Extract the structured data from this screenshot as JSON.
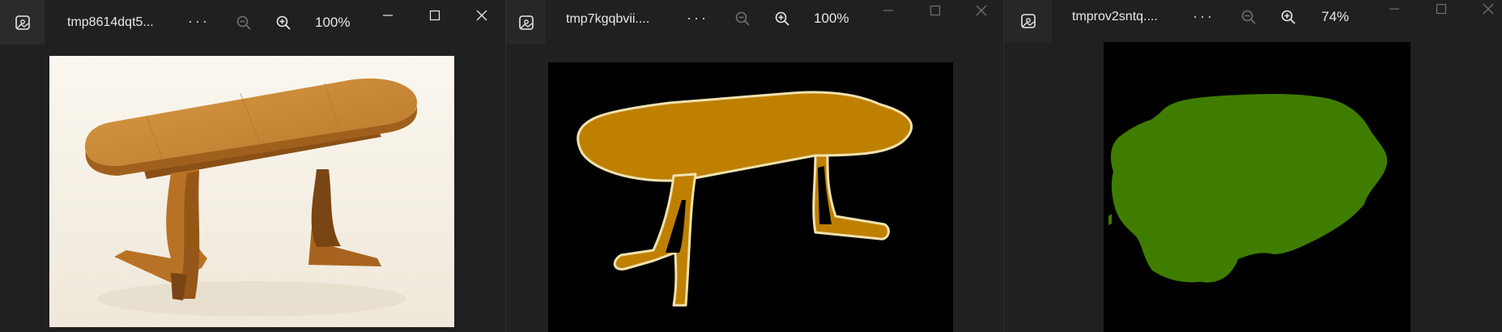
{
  "windows": [
    {
      "file_name": "tmp8614dqt5...",
      "zoom": "100%",
      "more": "···"
    },
    {
      "file_name": "tmp7kgqbvii....",
      "zoom": "100%",
      "more": "···"
    },
    {
      "file_name": "tmprov2sntq....",
      "zoom": "74%",
      "more": "···"
    }
  ],
  "colors": {
    "background": "#202020",
    "photo_bg": "#f3eee4",
    "wood": "#c0842f",
    "mask_table": "#bf8000",
    "mask_outline": "#f0e2b0",
    "mask_green": "#3f7d00"
  },
  "icons": [
    "photos-app-icon",
    "zoom-out-icon",
    "zoom-in-icon",
    "minimize-icon",
    "maximize-icon",
    "close-icon"
  ]
}
